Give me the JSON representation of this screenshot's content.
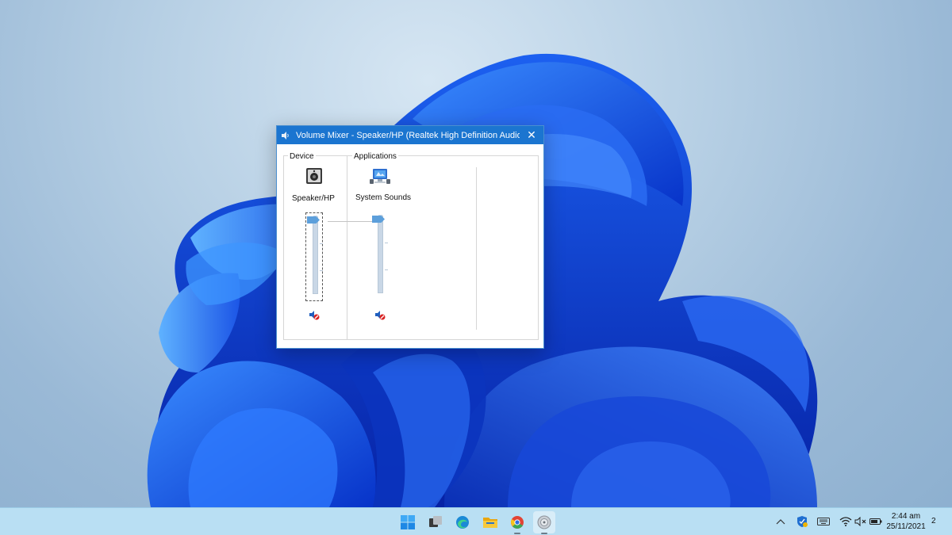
{
  "window": {
    "title": "Volume Mixer - Speaker/HP (Realtek High Definition Audio)",
    "close_glyph": "✕"
  },
  "device": {
    "group_label": "Device",
    "name": "Speaker/HP",
    "icon": "speaker-device-icon",
    "volume_percent": 100,
    "muted": true
  },
  "applications": {
    "group_label": "Applications",
    "items": [
      {
        "name": "System Sounds",
        "icon": "system-sounds-icon",
        "volume_percent": 100,
        "muted": true
      }
    ]
  },
  "taskbar": {
    "apps": [
      {
        "name": "start-icon"
      },
      {
        "name": "task-view-icon"
      },
      {
        "name": "edge-icon"
      },
      {
        "name": "file-explorer-icon"
      },
      {
        "name": "chrome-icon"
      },
      {
        "name": "volume-mixer-app-icon"
      }
    ],
    "tray": [
      "chevron-up-icon",
      "defender-icon",
      "keyboard-icon",
      "wifi-icon",
      "volume-muted-icon",
      "battery-icon"
    ],
    "clock": {
      "time": "2:44 am",
      "date": "25/11/2021"
    },
    "notification_count": "2"
  },
  "colors": {
    "titlebar": "#1b75d0",
    "taskbar": "#b9dff3",
    "slider_thumb": "#5c9fdb"
  }
}
